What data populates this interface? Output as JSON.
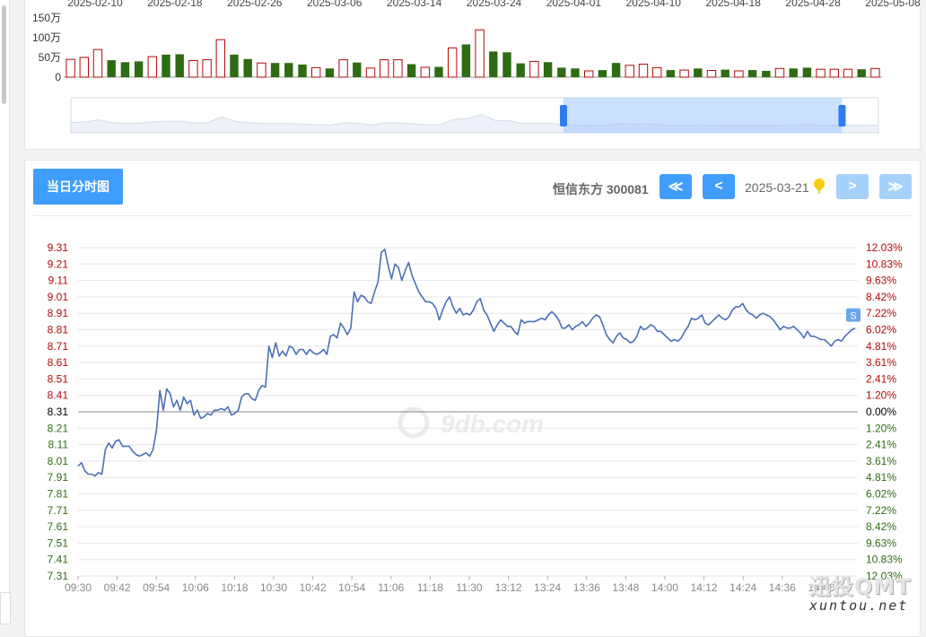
{
  "header": {
    "tab_label": "当日分时图",
    "stock_label": "恒信东方 300081",
    "date": "2025-03-21",
    "nav": {
      "first": "≪",
      "prev": "<",
      "next": ">",
      "last": "≫"
    }
  },
  "watermark": {
    "center": "9db.com",
    "brand": "迅投QMT",
    "url": "xuntou.net"
  },
  "colors": {
    "up": "#b4090b",
    "down": "#2e6b12",
    "line": "#4a6fb5",
    "accent": "#3f9dfc",
    "zero": "#000000"
  },
  "chart_data": [
    {
      "type": "bar",
      "title": "",
      "x_tick_labels": [
        "2025-02-10",
        "2025-02-18",
        "2025-02-26",
        "2025-03-06",
        "2025-03-14",
        "2025-03-24",
        "2025-04-01",
        "2025-04-10",
        "2025-04-18",
        "2025-04-28",
        "2025-05-08"
      ],
      "y_tick_labels": [
        "150万",
        "100万",
        "50万",
        "0"
      ],
      "ylim": [
        0,
        150
      ],
      "unit": "万",
      "values": [
        45,
        50,
        70,
        43,
        38,
        40,
        52,
        57,
        58,
        42,
        44,
        95,
        57,
        46,
        36,
        36,
        36,
        32,
        24,
        22,
        44,
        37,
        23,
        44,
        44,
        33,
        25,
        26,
        74,
        83,
        120,
        65,
        63,
        35,
        40,
        38,
        24,
        22,
        16,
        18,
        36,
        30,
        33,
        24,
        18,
        18,
        22,
        17,
        19,
        16,
        18,
        16,
        22,
        22,
        24,
        20,
        20,
        20,
        20,
        22
      ],
      "up_flags": [
        1,
        1,
        1,
        0,
        0,
        0,
        1,
        0,
        0,
        1,
        1,
        1,
        0,
        0,
        1,
        0,
        0,
        0,
        1,
        0,
        1,
        0,
        1,
        1,
        1,
        0,
        1,
        0,
        1,
        0,
        1,
        0,
        0,
        0,
        1,
        0,
        0,
        0,
        1,
        0,
        0,
        1,
        1,
        1,
        0,
        1,
        0,
        1,
        0,
        1,
        0,
        0,
        1,
        0,
        0,
        1,
        1,
        1,
        0,
        1
      ],
      "slider": {
        "start_fraction": 0.61,
        "end_fraction": 0.955
      }
    },
    {
      "type": "line",
      "title": "",
      "x_tick_labels": [
        "09:30",
        "09:42",
        "09:54",
        "10:06",
        "10:18",
        "10:30",
        "10:42",
        "10:54",
        "11:06",
        "11:18",
        "11:30",
        "13:12",
        "13:24",
        "13:36",
        "13:48",
        "14:00",
        "14:12",
        "14:24",
        "14:36",
        "14:48"
      ],
      "y_tick_labels": [
        "9.31",
        "9.21",
        "9.11",
        "9.01",
        "8.91",
        "8.81",
        "8.71",
        "8.61",
        "8.51",
        "8.41",
        "8.31",
        "8.21",
        "8.11",
        "8.01",
        "7.91",
        "7.81",
        "7.71",
        "7.61",
        "7.51",
        "7.41",
        "7.31"
      ],
      "pct_tick_labels": [
        "12.03%",
        "10.83%",
        "9.63%",
        "8.42%",
        "7.22%",
        "6.02%",
        "4.81%",
        "3.61%",
        "2.41%",
        "1.20%",
        "0.00%",
        "1.20%",
        "2.41%",
        "3.61%",
        "4.81%",
        "6.02%",
        "7.22%",
        "8.42%",
        "9.63%",
        "10.83%",
        "12.03%"
      ],
      "prev_close": 8.31,
      "ylim": [
        7.31,
        9.31
      ],
      "series": [
        {
          "marker": "S",
          "values": [
            7.98,
            8.0,
            7.95,
            7.93,
            7.93,
            7.92,
            7.94,
            7.93,
            8.08,
            8.12,
            8.09,
            8.13,
            8.14,
            8.1,
            8.1,
            8.1,
            8.07,
            8.05,
            8.04,
            8.05,
            8.06,
            8.04,
            8.08,
            8.2,
            8.44,
            8.32,
            8.45,
            8.42,
            8.34,
            8.38,
            8.32,
            8.4,
            8.36,
            8.38,
            8.29,
            8.32,
            8.27,
            8.28,
            8.3,
            8.29,
            8.32,
            8.32,
            8.33,
            8.32,
            8.34,
            8.29,
            8.3,
            8.32,
            8.4,
            8.42,
            8.42,
            8.39,
            8.38,
            8.44,
            8.47,
            8.46,
            8.71,
            8.64,
            8.73,
            8.65,
            8.68,
            8.65,
            8.71,
            8.7,
            8.66,
            8.69,
            8.69,
            8.66,
            8.69,
            8.67,
            8.66,
            8.67,
            8.69,
            8.66,
            8.77,
            8.78,
            8.76,
            8.85,
            8.82,
            8.78,
            8.82,
            9.04,
            8.98,
            9.02,
            9.01,
            8.98,
            8.97,
            9.04,
            9.1,
            9.28,
            9.3,
            9.2,
            9.12,
            9.21,
            9.19,
            9.11,
            9.17,
            9.22,
            9.14,
            9.09,
            9.04,
            9.01,
            8.98,
            8.98,
            8.97,
            8.94,
            8.87,
            8.93,
            8.98,
            9.01,
            8.95,
            8.91,
            8.94,
            8.9,
            8.91,
            8.9,
            8.93,
            8.98,
            9.0,
            8.93,
            8.9,
            8.85,
            8.8,
            8.84,
            8.87,
            8.85,
            8.83,
            8.83,
            8.8,
            8.78,
            8.87,
            8.85,
            8.86,
            8.86,
            8.86,
            8.87,
            8.88,
            8.87,
            8.9,
            8.92,
            8.9,
            8.87,
            8.82,
            8.82,
            8.84,
            8.81,
            8.83,
            8.84,
            8.86,
            8.83,
            8.85,
            8.88,
            8.9,
            8.89,
            8.84,
            8.78,
            8.75,
            8.73,
            8.77,
            8.79,
            8.76,
            8.75,
            8.73,
            8.74,
            8.77,
            8.83,
            8.81,
            8.82,
            8.84,
            8.83,
            8.8,
            8.8,
            8.78,
            8.76,
            8.74,
            8.75,
            8.74,
            8.76,
            8.8,
            8.83,
            8.88,
            8.87,
            8.88,
            8.9,
            8.85,
            8.84,
            8.86,
            8.88,
            8.9,
            8.88,
            8.87,
            8.89,
            8.93,
            8.95,
            8.95,
            8.97,
            8.93,
            8.91,
            8.9,
            8.88,
            8.9,
            8.91,
            8.9,
            8.89,
            8.87,
            8.84,
            8.81,
            8.83,
            8.82,
            8.82,
            8.83,
            8.81,
            8.79,
            8.76,
            8.8,
            8.77,
            8.77,
            8.76,
            8.75,
            8.75,
            8.73,
            8.71,
            8.74,
            8.75,
            8.74,
            8.77,
            8.79,
            8.81,
            8.82
          ]
        }
      ]
    }
  ]
}
